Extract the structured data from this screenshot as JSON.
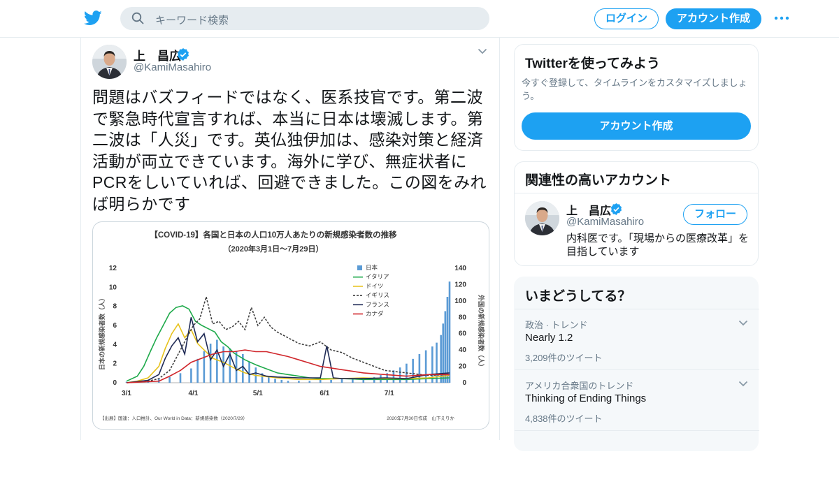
{
  "header": {
    "logo_icon": "twitter-bird-icon",
    "search_placeholder": "キーワード検索",
    "login_label": "ログイン",
    "signup_label": "アカウント作成",
    "more_icon": "more-dots-icon"
  },
  "tweet": {
    "author_name": "上　昌広",
    "handle": "@KamiMasahiro",
    "verified": true,
    "text": "問題はバズフィードではなく、医系技官です。第二波で緊急時代宣言すれば、本当に日本は壊滅します。第二波は「人災」です。英仏独伊加は、感染対策と経済活動が両立できています。海外に学び、無症状者にPCRをしいていれば、回避できました。この図をみれば明らかです",
    "media": {
      "title": "【COVID-19】各国と日本の人口10万人あたりの新規感染者数の推移",
      "subtitle": "（2020年3月1日～7月29日）",
      "left_axis_label": "日本の新規感染者数（人）",
      "right_axis_label": "外国の新規感染者数（人）",
      "left_ticks": [
        "12",
        "10",
        "8",
        "6",
        "4",
        "2",
        "0"
      ],
      "right_ticks": [
        "140",
        "120",
        "100",
        "80",
        "60",
        "40",
        "20",
        "0"
      ],
      "x_ticks": [
        "3/1",
        "4/1",
        "5/1",
        "6/1",
        "7/1"
      ],
      "legend": [
        "日本",
        "イタリア",
        "ドイツ",
        "イギリス",
        "フランス",
        "カナダ"
      ],
      "source": "【出展】国連：人口推計、Our World in Data：新規感染数（2020/7/29）",
      "credit": "2020年7月30日作成　山下えりか"
    }
  },
  "chart_data": {
    "type": "bar",
    "title": "【COVID-19】各国と日本の人口10万人あたりの新規感染者数の推移",
    "subtitle": "（2020年3月1日～7月29日）",
    "ylabel": "日本の新規感染者数（人）",
    "y2label": "外国の新規感染者数（人）",
    "ylim": [
      0,
      12
    ],
    "y2lim": [
      0,
      140
    ],
    "x_ticks": [
      "3/1",
      "4/1",
      "5/1",
      "6/1",
      "7/1"
    ],
    "x_range_days": [
      0,
      150
    ],
    "colors": {
      "日本": "#5b9bd5",
      "イタリア": "#1faa4b",
      "ドイツ": "#e7c21b",
      "イギリス": "#404040",
      "フランス": "#1f2a55",
      "カナダ": "#d0262b"
    },
    "series": [
      {
        "name": "日本",
        "type": "bar",
        "axis": "left",
        "x": [
          0,
          5,
          10,
          15,
          20,
          25,
          30,
          33,
          36,
          39,
          42,
          45,
          48,
          51,
          54,
          57,
          60,
          63,
          66,
          69,
          72,
          75,
          80,
          85,
          90,
          95,
          100,
          105,
          110,
          115,
          118,
          121,
          124,
          127,
          130,
          133,
          136,
          139,
          142,
          144,
          146,
          147,
          148,
          149,
          150
        ],
        "values": [
          0.1,
          0.2,
          0.3,
          0.4,
          0.6,
          1.0,
          1.5,
          2.5,
          3.3,
          4.1,
          4.5,
          3.8,
          3.6,
          3.3,
          3.0,
          2.2,
          1.6,
          1.0,
          0.6,
          0.4,
          0.3,
          0.2,
          0.2,
          0.2,
          0.3,
          0.3,
          0.4,
          0.5,
          0.5,
          0.6,
          0.8,
          1.0,
          1.3,
          1.6,
          2.0,
          2.5,
          3.0,
          3.4,
          3.8,
          4.2,
          5.0,
          6.2,
          7.5,
          9.0,
          10.6
        ]
      },
      {
        "name": "イタリア",
        "type": "line",
        "axis": "right",
        "x": [
          0,
          5,
          8,
          11,
          14,
          17,
          20,
          23,
          26,
          29,
          32,
          35,
          38,
          41,
          44,
          47,
          50,
          55,
          60,
          65,
          70,
          75,
          80,
          85,
          90,
          100,
          110,
          120,
          130,
          140,
          150
        ],
        "values": [
          2,
          8,
          20,
          38,
          55,
          70,
          85,
          92,
          94,
          90,
          75,
          70,
          66,
          62,
          50,
          44,
          36,
          28,
          22,
          17,
          12,
          10,
          8,
          6,
          5,
          5,
          4,
          4,
          4,
          5,
          6
        ]
      },
      {
        "name": "ドイツ",
        "type": "line",
        "axis": "right",
        "x": [
          0,
          5,
          10,
          15,
          18,
          21,
          24,
          27,
          30,
          33,
          36,
          40,
          45,
          50,
          55,
          60,
          70,
          80,
          90,
          100,
          110,
          120,
          130,
          140,
          150
        ],
        "values": [
          0,
          2,
          6,
          20,
          42,
          60,
          72,
          55,
          65,
          48,
          40,
          30,
          25,
          18,
          12,
          9,
          6,
          4,
          4,
          5,
          6,
          5,
          5,
          6,
          9
        ]
      },
      {
        "name": "イギリス",
        "type": "line",
        "axis": "right",
        "x": [
          0,
          10,
          15,
          20,
          25,
          28,
          31,
          34,
          37,
          40,
          43,
          46,
          49,
          52,
          55,
          58,
          61,
          64,
          67,
          70,
          75,
          80,
          85,
          90,
          95,
          100,
          105,
          110,
          115,
          120,
          130,
          140,
          150
        ],
        "values": [
          0,
          2,
          5,
          15,
          40,
          55,
          70,
          78,
          105,
          72,
          75,
          65,
          68,
          75,
          65,
          92,
          70,
          80,
          68,
          62,
          55,
          48,
          45,
          50,
          40,
          37,
          30,
          25,
          20,
          15,
          12,
          9,
          10
        ]
      },
      {
        "name": "フランス",
        "type": "line",
        "axis": "right",
        "x": [
          0,
          10,
          15,
          18,
          21,
          24,
          27,
          30,
          33,
          36,
          39,
          42,
          45,
          48,
          51,
          54,
          57,
          60,
          65,
          70,
          80,
          90,
          93,
          96,
          100,
          110,
          120,
          130,
          140,
          150
        ],
        "values": [
          0,
          3,
          10,
          30,
          45,
          55,
          35,
          80,
          50,
          60,
          28,
          40,
          20,
          35,
          15,
          20,
          10,
          12,
          8,
          7,
          6,
          6,
          45,
          6,
          5,
          5,
          6,
          5,
          10,
          12
        ]
      },
      {
        "name": "カナダ",
        "type": "line",
        "axis": "right",
        "x": [
          0,
          15,
          20,
          25,
          30,
          35,
          40,
          45,
          50,
          55,
          60,
          65,
          70,
          75,
          80,
          85,
          90,
          95,
          100,
          105,
          110,
          120,
          130,
          140,
          150
        ],
        "values": [
          0,
          2,
          8,
          15,
          25,
          30,
          35,
          38,
          38,
          40,
          38,
          38,
          35,
          32,
          28,
          24,
          20,
          18,
          16,
          14,
          12,
          10,
          8,
          10,
          10
        ]
      }
    ]
  },
  "sidebar": {
    "try": {
      "title": "Twitterを使ってみよう",
      "description": "今すぐ登録して、タイムラインをカスタマイズしましょう。",
      "button": "アカウント作成"
    },
    "related": {
      "title": "関連性の高いアカウント",
      "name": "上　昌広",
      "handle": "@KamiMasahiro",
      "follow": "フォロー",
      "bio": "内科医です。「現場からの医療改革」を目指しています"
    },
    "trends": {
      "title": "いまどうしてる？",
      "items": [
        {
          "context": "政治 · トレンド",
          "name": "Nearly 1.2",
          "count": "3,209件のツイート"
        },
        {
          "context": "アメリカ合衆国のトレンド",
          "name": "Thinking of Ending Things",
          "count": "4,838件のツイート"
        }
      ]
    }
  },
  "colors": {
    "brand": "#1da1f2",
    "muted": "#657786",
    "border": "#e6ecf0"
  }
}
